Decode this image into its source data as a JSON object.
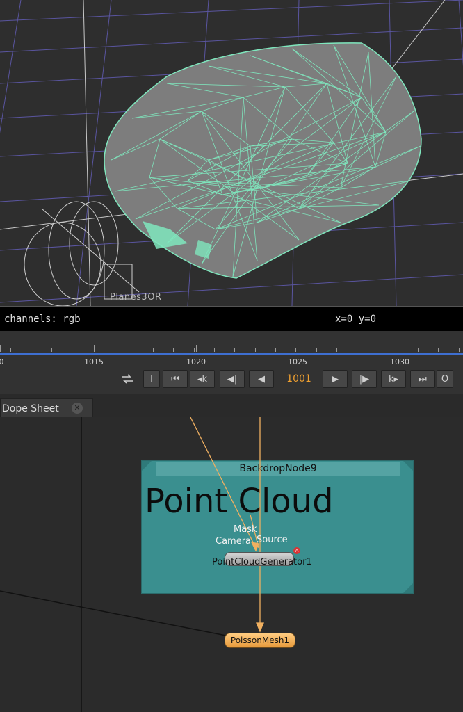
{
  "viewer": {
    "grid_label": "Planes3OR"
  },
  "infobar": {
    "channels": "channels: rgb",
    "coords": "x=0 y=0"
  },
  "timeline": {
    "ticks": [
      "0",
      "1015",
      "1020",
      "1025",
      "1030"
    ]
  },
  "transport": {
    "loop_icon": "loop-icon",
    "in_label": "I",
    "out_label": "O",
    "current_frame": "1001",
    "buttons": [
      {
        "name": "first-frame-icon",
        "glyph": "⏮"
      },
      {
        "name": "prev-keyframe-icon",
        "glyph": "◂k"
      },
      {
        "name": "prev-increment-icon",
        "glyph": "◀|"
      },
      {
        "name": "play-backward-icon",
        "glyph": "◀"
      },
      {
        "name": "play-forward-icon",
        "glyph": "▶"
      },
      {
        "name": "next-increment-icon",
        "glyph": "|▶"
      },
      {
        "name": "next-keyframe-icon",
        "glyph": "k▸"
      },
      {
        "name": "last-frame-icon",
        "glyph": "⏭"
      }
    ]
  },
  "tabbar": {
    "tab_label": "Dope Sheet",
    "close_glyph": "✕"
  },
  "nodegraph": {
    "backdrop_name": "BackdropNode9",
    "backdrop_title": "Point Cloud",
    "port_mask": "Mask",
    "port_camera": "Camera",
    "port_source": "Source",
    "node_pcg": "PointCloudGenerator1",
    "node_pm": "PoissonMesh1",
    "badge": "A"
  },
  "colors": {
    "mesh_wire": "#7fe6bd",
    "mesh_fill": "#7a7a7a",
    "backdrop": "#3a8f8f",
    "wire": "#f0b060",
    "timeline_bar": "#3e6fd1",
    "frame_number": "#f0a030"
  }
}
